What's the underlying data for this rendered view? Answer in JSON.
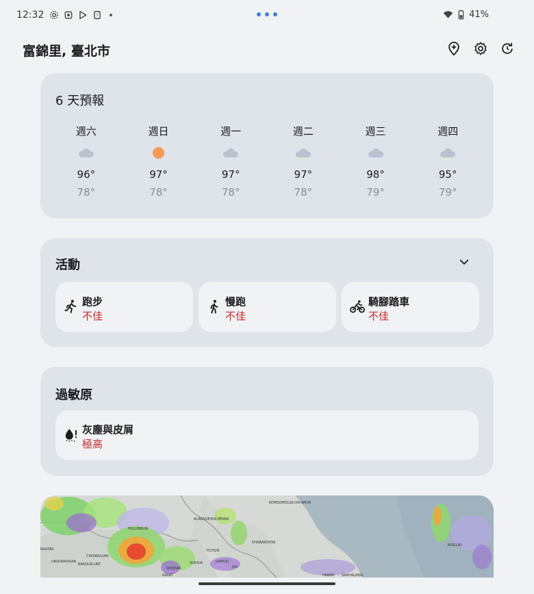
{
  "status_bar": {
    "time": "12:32",
    "battery": "41%"
  },
  "header": {
    "location": "富錦里, 臺北市",
    "actions": [
      "add-location-icon",
      "gear-icon",
      "refresh-icon"
    ]
  },
  "forecast": {
    "title": "6 天預報",
    "days": [
      {
        "name": "週六",
        "icon": "cloud",
        "high": "96°",
        "low": "78°"
      },
      {
        "name": "週日",
        "icon": "sun",
        "high": "97°",
        "low": "78°"
      },
      {
        "name": "週一",
        "icon": "cloud",
        "high": "97°",
        "low": "78°"
      },
      {
        "name": "週二",
        "icon": "cloud",
        "high": "97°",
        "low": "78°"
      },
      {
        "name": "週三",
        "icon": "cloud",
        "high": "98°",
        "low": "79°"
      },
      {
        "name": "週四",
        "icon": "cloud",
        "high": "95°",
        "low": "79°"
      }
    ]
  },
  "activities": {
    "title": "活動",
    "items": [
      {
        "label": "跑步",
        "status": "不佳",
        "icon": "running-icon"
      },
      {
        "label": "慢跑",
        "status": "不佳",
        "icon": "walking-icon"
      },
      {
        "label": "騎腳踏車",
        "status": "不佳",
        "icon": "cycling-icon"
      }
    ]
  },
  "allergens": {
    "title": "過敏原",
    "items": [
      {
        "label": "灰塵與皮屑",
        "status": "極高",
        "icon": "dust-icon"
      }
    ]
  },
  "map": {
    "labels": [
      "KOMSOMOLSK-ON-AMUR",
      "HULUNBUIR",
      "BLAGOVESHCHENSK",
      "KHABAROVSK",
      "CHOIBALSAN",
      "BAATAR",
      "UNDURKHAAN",
      "BARUUN-URT",
      "YICHUN",
      "QIQIHAR",
      "SUIHUA",
      "JIAMUSI",
      "JIXI",
      "KIRIAT",
      "NOGLIKI",
      "HAWAY",
      "SAKHALINSK"
    ]
  },
  "colors": {
    "card_bg": "#dfe3ea",
    "tile_bg": "#f1f2f4",
    "alert": "#c62828",
    "sun": "#f79b54",
    "cloud": "#b9c3d0",
    "accent": "#3f7fd0"
  }
}
